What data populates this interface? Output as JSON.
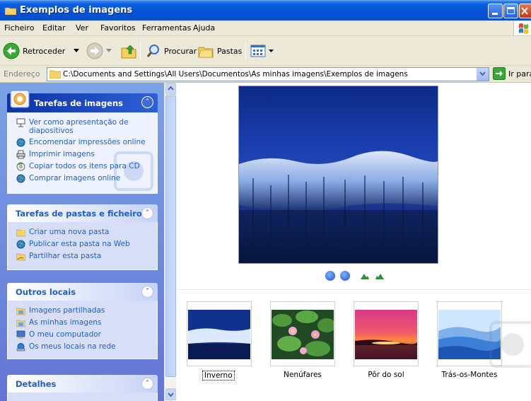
{
  "window": {
    "title": "Exemplos de imagens"
  },
  "menu": {
    "items": [
      "Ficheiro",
      "Editar",
      "Ver",
      "Favoritos",
      "Ferramentas",
      "Ajuda"
    ]
  },
  "toolbar": {
    "back_label": "Retroceder",
    "search_label": "Procurar",
    "folders_label": "Pastas"
  },
  "address": {
    "label": "Endereço",
    "path": "C:\\Documents and Settings\\All Users\\Documentos\\As minhas imagens\\Exemplos de imagens",
    "go_label": "Ir para"
  },
  "sidebar": {
    "image_tasks": {
      "title": "Tarefas de imagens",
      "items": [
        "Ver como apresentação de diapositivos",
        "Encomendar impressões online",
        "Imprimir imagens",
        "Copiar todos os itens para CD",
        "Comprar imagens online"
      ]
    },
    "folder_tasks": {
      "title": "Tarefas de pastas e ficheiros",
      "items": [
        "Criar uma nova pasta",
        "Publicar esta pasta na Web",
        "Partilhar esta pasta"
      ]
    },
    "other_places": {
      "title": "Outros locais",
      "items": [
        "Imagens partilhadas",
        "As minhas imagens",
        "O meu computador",
        "Os meus locais na rede"
      ]
    },
    "details": {
      "title": "Detalhes"
    }
  },
  "filmstrip": {
    "items": [
      {
        "label": "Inverno",
        "selected": true
      },
      {
        "label": "Nenúfares",
        "selected": false
      },
      {
        "label": "Pôr do sol",
        "selected": false
      },
      {
        "label": "Trás-os-Montes",
        "selected": false
      }
    ]
  },
  "colors": {
    "title_bar": "#0553d6",
    "task_link": "#215dc6",
    "sidebar_bg": "#6375d6"
  }
}
